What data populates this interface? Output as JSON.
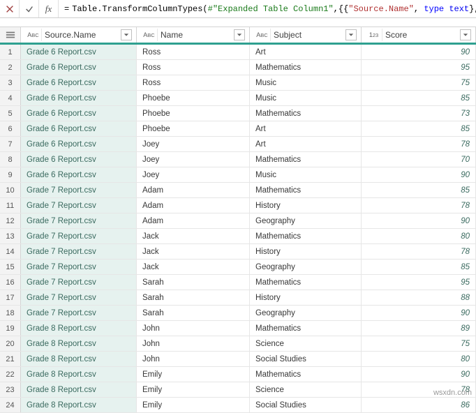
{
  "formula": {
    "raw": "= Table.TransformColumnTypes(#\"Expanded Table Column1\",{{\"Source.Name\", type text},"
  },
  "fxSymbol": "fx",
  "columns": [
    {
      "label": "Source.Name",
      "typeIcon": "ABC"
    },
    {
      "label": "Name",
      "typeIcon": "ABC"
    },
    {
      "label": "Subject",
      "typeIcon": "ABC"
    },
    {
      "label": "Score",
      "typeIcon": "123"
    }
  ],
  "rows": [
    {
      "n": 1,
      "source": "Grade 6 Report.csv",
      "name": "Ross",
      "subject": "Art",
      "score": 90
    },
    {
      "n": 2,
      "source": "Grade 6 Report.csv",
      "name": "Ross",
      "subject": "Mathematics",
      "score": 95
    },
    {
      "n": 3,
      "source": "Grade 6 Report.csv",
      "name": "Ross",
      "subject": "Music",
      "score": 75
    },
    {
      "n": 4,
      "source": "Grade 6 Report.csv",
      "name": "Phoebe",
      "subject": "Music",
      "score": 85
    },
    {
      "n": 5,
      "source": "Grade 6 Report.csv",
      "name": "Phoebe",
      "subject": "Mathematics",
      "score": 73
    },
    {
      "n": 6,
      "source": "Grade 6 Report.csv",
      "name": "Phoebe",
      "subject": "Art",
      "score": 85
    },
    {
      "n": 7,
      "source": "Grade 6 Report.csv",
      "name": "Joey",
      "subject": "Art",
      "score": 78
    },
    {
      "n": 8,
      "source": "Grade 6 Report.csv",
      "name": "Joey",
      "subject": "Mathematics",
      "score": 70
    },
    {
      "n": 9,
      "source": "Grade 6 Report.csv",
      "name": "Joey",
      "subject": "Music",
      "score": 90
    },
    {
      "n": 10,
      "source": "Grade 7 Report.csv",
      "name": "Adam",
      "subject": "Mathematics",
      "score": 85
    },
    {
      "n": 11,
      "source": "Grade 7 Report.csv",
      "name": "Adam",
      "subject": "History",
      "score": 78
    },
    {
      "n": 12,
      "source": "Grade 7 Report.csv",
      "name": "Adam",
      "subject": "Geography",
      "score": 90
    },
    {
      "n": 13,
      "source": "Grade 7 Report.csv",
      "name": "Jack",
      "subject": "Mathematics",
      "score": 80
    },
    {
      "n": 14,
      "source": "Grade 7 Report.csv",
      "name": "Jack",
      "subject": "History",
      "score": 78
    },
    {
      "n": 15,
      "source": "Grade 7 Report.csv",
      "name": "Jack",
      "subject": "Geography",
      "score": 85
    },
    {
      "n": 16,
      "source": "Grade 7 Report.csv",
      "name": "Sarah",
      "subject": "Mathematics",
      "score": 95
    },
    {
      "n": 17,
      "source": "Grade 7 Report.csv",
      "name": "Sarah",
      "subject": "History",
      "score": 88
    },
    {
      "n": 18,
      "source": "Grade 7 Report.csv",
      "name": "Sarah",
      "subject": "Geography",
      "score": 90
    },
    {
      "n": 19,
      "source": "Grade 8 Report.csv",
      "name": "John",
      "subject": "Mathematics",
      "score": 89
    },
    {
      "n": 20,
      "source": "Grade 8 Report.csv",
      "name": "John",
      "subject": "Science",
      "score": 75
    },
    {
      "n": 21,
      "source": "Grade 8 Report.csv",
      "name": "John",
      "subject": "Social Studies",
      "score": 80
    },
    {
      "n": 22,
      "source": "Grade 8 Report.csv",
      "name": "Emily",
      "subject": "Mathematics",
      "score": 90
    },
    {
      "n": 23,
      "source": "Grade 8 Report.csv",
      "name": "Emily",
      "subject": "Science",
      "score": 78
    },
    {
      "n": 24,
      "source": "Grade 8 Report.csv",
      "name": "Emily",
      "subject": "Social Studies",
      "score": 86
    }
  ],
  "watermark": "wsxdn.com"
}
